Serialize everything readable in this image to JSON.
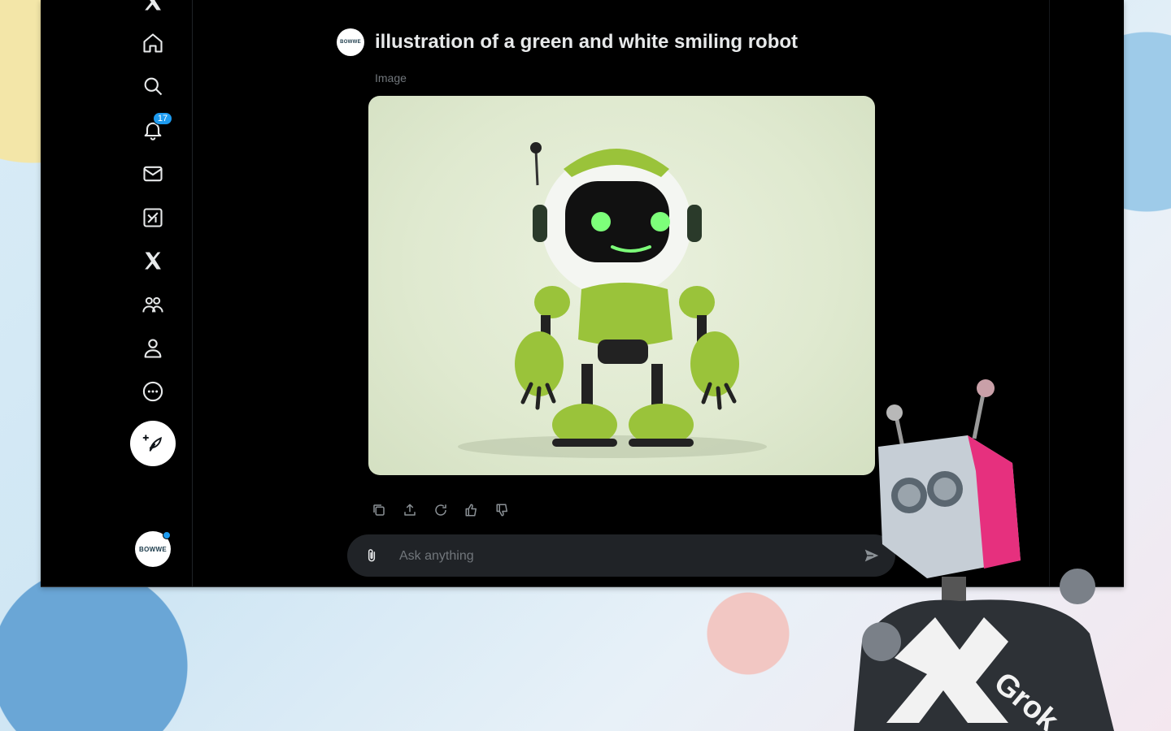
{
  "sidebar": {
    "items": [
      {
        "name": "x-logo",
        "icon": "x-logo-icon"
      },
      {
        "name": "home",
        "icon": "home-icon"
      },
      {
        "name": "explore",
        "icon": "search-icon"
      },
      {
        "name": "notifications",
        "icon": "bell-icon",
        "badge": "17"
      },
      {
        "name": "messages",
        "icon": "mail-icon"
      },
      {
        "name": "grok",
        "icon": "grok-icon"
      },
      {
        "name": "premium",
        "icon": "x-icon"
      },
      {
        "name": "communities",
        "icon": "people-icon"
      },
      {
        "name": "profile",
        "icon": "person-icon"
      },
      {
        "name": "more",
        "icon": "more-icon"
      }
    ],
    "compose_icon": "feather-plus-icon",
    "account_avatar_text": "BOWWE"
  },
  "conversation": {
    "avatar_text": "BOWWE",
    "prompt": "illustration of a green and white smiling robot",
    "image_label": "Image",
    "actions": [
      "copy-icon",
      "share-icon",
      "regenerate-icon",
      "thumbs-up-icon",
      "thumbs-down-icon"
    ]
  },
  "composer": {
    "placeholder": "Ask anything",
    "attach_icon": "paperclip-icon",
    "send_icon": "send-icon"
  },
  "overlay": {
    "mascot_text": "Grok",
    "mascot_logo": "X"
  },
  "colors": {
    "background": "#000000",
    "accent": "#1d9bf0",
    "text": "#e7e9ea",
    "muted": "#71767b",
    "input": "#202327",
    "robot_green": "#9ac33a"
  }
}
